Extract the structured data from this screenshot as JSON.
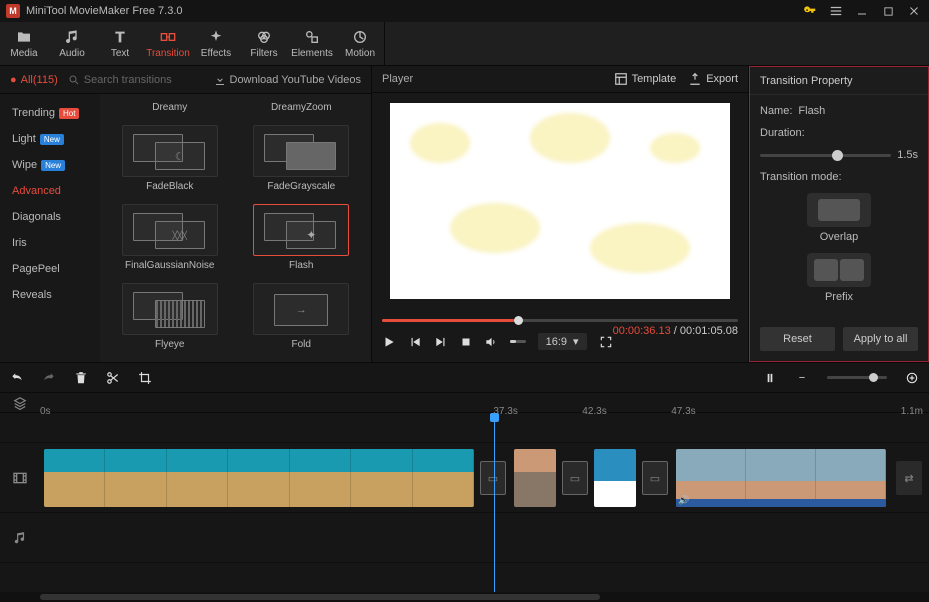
{
  "titlebar": {
    "app_title": "MiniTool MovieMaker Free 7.3.0"
  },
  "tabs": [
    {
      "id": "media",
      "label": "Media"
    },
    {
      "id": "audio",
      "label": "Audio"
    },
    {
      "id": "text",
      "label": "Text"
    },
    {
      "id": "transition",
      "label": "Transition"
    },
    {
      "id": "effects",
      "label": "Effects"
    },
    {
      "id": "filters",
      "label": "Filters"
    },
    {
      "id": "elements",
      "label": "Elements"
    },
    {
      "id": "motion",
      "label": "Motion"
    }
  ],
  "browser": {
    "count_label": "All(115)",
    "search_placeholder": "Search transitions",
    "download_label": "Download YouTube Videos",
    "categories": [
      {
        "label": "Trending",
        "badge": "Hot",
        "badge_kind": "hot"
      },
      {
        "label": "Light",
        "badge": "New",
        "badge_kind": "new"
      },
      {
        "label": "Wipe",
        "badge": "New",
        "badge_kind": "new"
      },
      {
        "label": "Advanced",
        "active": true
      },
      {
        "label": "Diagonals"
      },
      {
        "label": "Iris"
      },
      {
        "label": "PagePeel"
      },
      {
        "label": "Reveals"
      }
    ],
    "items": [
      {
        "label": "Dreamy"
      },
      {
        "label": "DreamyZoom"
      },
      {
        "label": "FadeBlack"
      },
      {
        "label": "FadeGrayscale"
      },
      {
        "label": "FinalGaussianNoise"
      },
      {
        "label": "Flash",
        "selected": true
      },
      {
        "label": "Flyeye"
      },
      {
        "label": "Fold"
      }
    ]
  },
  "player": {
    "title": "Player",
    "template_label": "Template",
    "export_label": "Export",
    "current_time": "00:00:36.13",
    "total_time": "00:01:05.08",
    "progress_pct": 37,
    "aspect": "16:9"
  },
  "props": {
    "title": "Transition Property",
    "name_label": "Name:",
    "name_value": "Flash",
    "duration_label": "Duration:",
    "duration_value": "1.5s",
    "duration_pct": 55,
    "mode_label": "Transition mode:",
    "mode_overlap": "Overlap",
    "mode_prefix": "Prefix",
    "reset": "Reset",
    "apply": "Apply to all"
  },
  "timeline": {
    "start": "0s",
    "ticks": [
      "37.3s",
      "42.3s",
      "47.3s",
      "1.1m"
    ],
    "playhead_pct": 51
  }
}
